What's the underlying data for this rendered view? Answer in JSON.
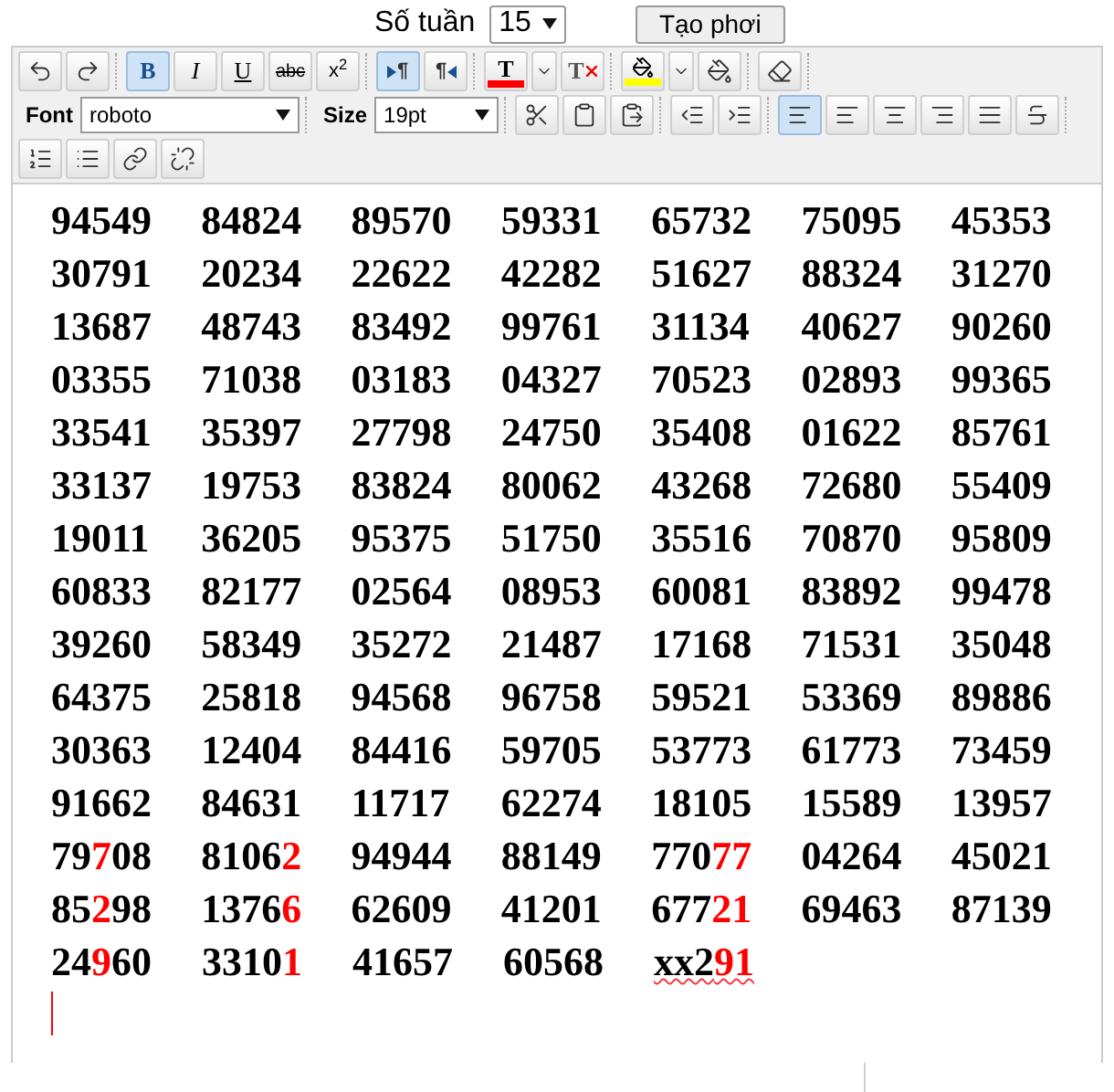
{
  "top_bar": {
    "week_label": "Số tuần",
    "week_select": "15",
    "create_button": "Tạo phơi"
  },
  "toolbar": {
    "row_1": [
      [
        {
          "kind": "undo",
          "selected": false
        },
        {
          "kind": "redo",
          "selected": false
        }
      ],
      [
        {
          "kind": "bold",
          "label": "B",
          "selected": true
        },
        {
          "kind": "italic",
          "label": "I",
          "selected": false
        },
        {
          "kind": "underline",
          "label": "U",
          "selected": false
        },
        {
          "kind": "strike",
          "label": "abc",
          "selected": false
        },
        {
          "kind": "superscript",
          "label": "x$^{2}$",
          "selected": false
        }
      ],
      [
        {
          "kind": "ltr",
          "label": "¶",
          "selected": true
        },
        {
          "kind": "rtl",
          "label": "¶",
          "selected": false
        }
      ],
      [
        {
          "kind": "text-color",
          "label": "T",
          "color": "#ff0000",
          "selected": false
        },
        {
          "kind": "dropdown",
          "selected": false
        },
        {
          "kind": "remove-text-color",
          "label": "T",
          "selected": false
        }
      ],
      [
        {
          "kind": "highlight",
          "color": "#ffff00",
          "selected": false
        },
        {
          "kind": "dropdown",
          "selected": false
        },
        {
          "kind": "remove-highlight",
          "selected": false
        }
      ],
      [
        {
          "kind": "eraser",
          "selected": false
        }
      ]
    ],
    "font_label": "Font",
    "font_value": "roboto",
    "size_label": "Size",
    "size_value": "19pt",
    "row_2": [
      [
        {
          "kind": "cut",
          "selected": false
        },
        {
          "kind": "paste",
          "selected": false
        },
        {
          "kind": "paste-word",
          "selected": false
        }
      ],
      [
        {
          "kind": "outdent",
          "selected": false
        },
        {
          "kind": "indent",
          "selected": false
        }
      ],
      [
        {
          "kind": "para-left",
          "selected": true
        },
        {
          "kind": "align-left",
          "selected": false
        },
        {
          "kind": "align-center",
          "selected": false
        },
        {
          "kind": "align-right",
          "selected": false
        },
        {
          "kind": "justify",
          "selected": false
        },
        {
          "kind": "justify-strike",
          "selected": false
        }
      ]
    ],
    "row_3": [
      {
        "kind": "ordered-list",
        "selected": false
      },
      {
        "kind": "bullet-list",
        "selected": false
      },
      {
        "kind": "link",
        "selected": false
      },
      {
        "kind": "unlink",
        "selected": false
      }
    ]
  },
  "editor": {
    "rows": [
      [
        [
          {
            "t": "94549",
            "red": false
          }
        ],
        [
          {
            "t": "84824",
            "red": false
          }
        ],
        [
          {
            "t": "89570",
            "red": false
          }
        ],
        [
          {
            "t": "59331",
            "red": false
          }
        ],
        [
          {
            "t": "65732",
            "red": false
          }
        ],
        [
          {
            "t": "75095",
            "red": false
          }
        ],
        [
          {
            "t": "45353",
            "red": false
          }
        ]
      ],
      [
        [
          {
            "t": "30791",
            "red": false
          }
        ],
        [
          {
            "t": "20234",
            "red": false
          }
        ],
        [
          {
            "t": "22622",
            "red": false
          }
        ],
        [
          {
            "t": "42282",
            "red": false
          }
        ],
        [
          {
            "t": "51627",
            "red": false
          }
        ],
        [
          {
            "t": "88324",
            "red": false
          }
        ],
        [
          {
            "t": "31270",
            "red": false
          }
        ]
      ],
      [
        [
          {
            "t": "13687",
            "red": false
          }
        ],
        [
          {
            "t": "48743",
            "red": false
          }
        ],
        [
          {
            "t": "83492",
            "red": false
          }
        ],
        [
          {
            "t": "99761",
            "red": false
          }
        ],
        [
          {
            "t": "31134",
            "red": false
          }
        ],
        [
          {
            "t": "40627",
            "red": false
          }
        ],
        [
          {
            "t": "90260",
            "red": false
          }
        ]
      ],
      [
        [
          {
            "t": "03355",
            "red": false
          }
        ],
        [
          {
            "t": "71038",
            "red": false
          }
        ],
        [
          {
            "t": "03183",
            "red": false
          }
        ],
        [
          {
            "t": "04327",
            "red": false
          }
        ],
        [
          {
            "t": "70523",
            "red": false
          }
        ],
        [
          {
            "t": "02893",
            "red": false
          }
        ],
        [
          {
            "t": "99365",
            "red": false
          }
        ]
      ],
      [
        [
          {
            "t": "33541",
            "red": false
          }
        ],
        [
          {
            "t": "35397",
            "red": false
          }
        ],
        [
          {
            "t": "27798",
            "red": false
          }
        ],
        [
          {
            "t": "24750",
            "red": false
          }
        ],
        [
          {
            "t": "35408",
            "red": false
          }
        ],
        [
          {
            "t": "01622",
            "red": false
          }
        ],
        [
          {
            "t": "85761",
            "red": false
          }
        ]
      ],
      [
        [
          {
            "t": "33137",
            "red": false
          }
        ],
        [
          {
            "t": "19753",
            "red": false
          }
        ],
        [
          {
            "t": "83824",
            "red": false
          }
        ],
        [
          {
            "t": "80062",
            "red": false
          }
        ],
        [
          {
            "t": "43268",
            "red": false
          }
        ],
        [
          {
            "t": "72680",
            "red": false
          }
        ],
        [
          {
            "t": "55409",
            "red": false
          }
        ]
      ],
      [
        [
          {
            "t": "19011",
            "red": false
          }
        ],
        [
          {
            "t": "36205",
            "red": false
          }
        ],
        [
          {
            "t": "95375",
            "red": false
          }
        ],
        [
          {
            "t": "51750",
            "red": false
          }
        ],
        [
          {
            "t": "35516",
            "red": false
          }
        ],
        [
          {
            "t": "70870",
            "red": false
          }
        ],
        [
          {
            "t": "95809",
            "red": false
          }
        ]
      ],
      [
        [
          {
            "t": "60833",
            "red": false
          }
        ],
        [
          {
            "t": "82177",
            "red": false
          }
        ],
        [
          {
            "t": "02564",
            "red": false
          }
        ],
        [
          {
            "t": "08953",
            "red": false
          }
        ],
        [
          {
            "t": "60081",
            "red": false
          }
        ],
        [
          {
            "t": "83892",
            "red": false
          }
        ],
        [
          {
            "t": "99478",
            "red": false
          }
        ]
      ],
      [
        [
          {
            "t": "39260",
            "red": false
          }
        ],
        [
          {
            "t": "58349",
            "red": false
          }
        ],
        [
          {
            "t": "35272",
            "red": false
          }
        ],
        [
          {
            "t": "21487",
            "red": false
          }
        ],
        [
          {
            "t": "17168",
            "red": false
          }
        ],
        [
          {
            "t": "71531",
            "red": false
          }
        ],
        [
          {
            "t": "35048",
            "red": false
          }
        ]
      ],
      [
        [
          {
            "t": "64375",
            "red": false
          }
        ],
        [
          {
            "t": "25818",
            "red": false
          }
        ],
        [
          {
            "t": "94568",
            "red": false
          }
        ],
        [
          {
            "t": "96758",
            "red": false
          }
        ],
        [
          {
            "t": "59521",
            "red": false
          }
        ],
        [
          {
            "t": "53369",
            "red": false
          }
        ],
        [
          {
            "t": "89886",
            "red": false
          }
        ]
      ],
      [
        [
          {
            "t": "30363",
            "red": false
          }
        ],
        [
          {
            "t": "12404",
            "red": false
          }
        ],
        [
          {
            "t": "84416",
            "red": false
          }
        ],
        [
          {
            "t": "59705",
            "red": false
          }
        ],
        [
          {
            "t": "53773",
            "red": false
          }
        ],
        [
          {
            "t": "61773",
            "red": false
          }
        ],
        [
          {
            "t": "73459",
            "red": false
          }
        ]
      ],
      [
        [
          {
            "t": "91662",
            "red": false
          }
        ],
        [
          {
            "t": "84631",
            "red": false
          }
        ],
        [
          {
            "t": "11717",
            "red": false
          }
        ],
        [
          {
            "t": "62274",
            "red": false
          }
        ],
        [
          {
            "t": "18105",
            "red": false
          }
        ],
        [
          {
            "t": "15589",
            "red": false
          }
        ],
        [
          {
            "t": "13957",
            "red": false
          }
        ]
      ],
      [
        [
          {
            "t": "79",
            "red": false
          },
          {
            "t": "7",
            "red": true
          },
          {
            "t": "08",
            "red": false
          }
        ],
        [
          {
            "t": "8106",
            "red": false
          },
          {
            "t": "2",
            "red": true
          }
        ],
        [
          {
            "t": "94944",
            "red": false
          }
        ],
        [
          {
            "t": "88149",
            "red": false
          }
        ],
        [
          {
            "t": "770",
            "red": false
          },
          {
            "t": "77",
            "red": true
          }
        ],
        [
          {
            "t": "04264",
            "red": false
          }
        ],
        [
          {
            "t": "45021",
            "red": false
          }
        ]
      ],
      [
        [
          {
            "t": "85",
            "red": false
          },
          {
            "t": "2",
            "red": true
          },
          {
            "t": "98",
            "red": false
          }
        ],
        [
          {
            "t": "1376",
            "red": false
          },
          {
            "t": "6",
            "red": true
          }
        ],
        [
          {
            "t": "62609",
            "red": false
          }
        ],
        [
          {
            "t": "41201",
            "red": false
          }
        ],
        [
          {
            "t": "677",
            "red": false
          },
          {
            "t": "21",
            "red": true
          }
        ],
        [
          {
            "t": "69463",
            "red": false
          }
        ],
        [
          {
            "t": "87139",
            "red": false
          }
        ]
      ],
      [
        [
          {
            "t": "24",
            "red": false
          },
          {
            "t": "9",
            "red": true
          },
          {
            "t": "60",
            "red": false
          }
        ],
        [
          {
            "t": "3310",
            "red": false
          },
          {
            "t": "1",
            "red": true
          }
        ],
        [
          {
            "t": "41657",
            "red": false
          }
        ],
        [
          {
            "t": "60568",
            "red": false
          }
        ],
        [
          {
            "t": "xx2",
            "red": false,
            "misspelled": true
          },
          {
            "t": "91",
            "red": true,
            "misspelled": true
          }
        ]
      ]
    ]
  }
}
